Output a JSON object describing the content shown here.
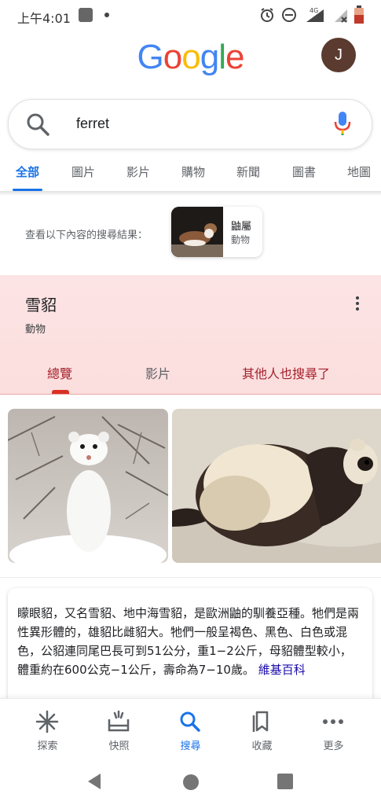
{
  "status_bar": {
    "time": "上午4:01",
    "network": "4G"
  },
  "header": {
    "logo_text": "Google",
    "avatar_initial": "J",
    "avatar_color": "#5b3a2f"
  },
  "search": {
    "query": "ferret"
  },
  "tabs": [
    "全部",
    "圖片",
    "影片",
    "購物",
    "新聞",
    "圖書",
    "地圖"
  ],
  "see_results": {
    "label": "查看以下內容的搜尋結果：",
    "entity_name": "鼬屬",
    "entity_type": "動物"
  },
  "knowledge_panel": {
    "title": "雪貂",
    "subtitle": "動物",
    "tabs": [
      "總覽",
      "影片",
      "其他人也搜尋了"
    ],
    "accent_color": "#a5202b"
  },
  "description": {
    "text": "矇眼貂，又名雪貂、地中海雪貂，是歐洲鼬的馴養亞種。牠們是兩性異形體的，雄貂比雌貂大。牠們一般呈褐色、黑色、白色或混色，公貂連同尾巴長可到51公分，重1−2公斤，母貂體型較小，體重約在600公克−1公斤，壽命為7−10歲。",
    "source_link": "維基百科"
  },
  "bottom_nav": [
    {
      "label": "探索",
      "icon": "asterisk-icon"
    },
    {
      "label": "快照",
      "icon": "snapshot-icon"
    },
    {
      "label": "搜尋",
      "icon": "search-icon"
    },
    {
      "label": "收藏",
      "icon": "bookmark-icon"
    },
    {
      "label": "更多",
      "icon": "more-horizontal-icon"
    }
  ],
  "colors": {
    "link_blue": "#1a73e8",
    "kp_background": "#fde4e4"
  }
}
